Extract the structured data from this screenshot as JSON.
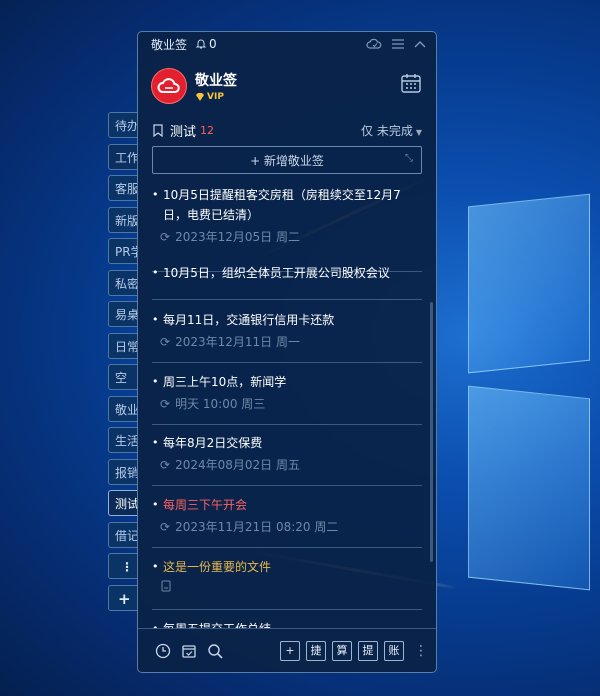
{
  "app": {
    "title": "敬业签",
    "bell_count": "0",
    "user_name": "敬业签",
    "vip_label": "VIP"
  },
  "side_tabs": [
    "待办",
    "工作",
    "客服",
    "新版",
    "PR学",
    "私密",
    "易桌",
    "日常",
    "空",
    "敬业",
    "生活",
    "报销",
    "测试",
    "借记"
  ],
  "side_tab_more": "⋮",
  "side_tab_add": "+",
  "list": {
    "name": "测试",
    "count": "12",
    "filter": "仅 未完成"
  },
  "add_button": "+ 新增敬业签",
  "notes": [
    {
      "title": "10月5日提醒租客交房租（房租续交至12月7日，电费已结清）",
      "meta": "2023年12月05日 周二"
    },
    {
      "title": "10月5日，组织全体员工开展公司股权会议",
      "meta": ""
    },
    {
      "title": "每月11日，交通银行信用卡还款",
      "meta": "2023年12月11日 周一"
    },
    {
      "title": "周三上午10点，新闻学",
      "meta": "明天 10:00 周三"
    },
    {
      "title": "每年8月2日交保费",
      "meta": "2024年08月02日 周五"
    },
    {
      "title": "每周三下午开会",
      "meta": "2023年11月21日 08:20 周二"
    },
    {
      "title": "这是一份重要的文件",
      "meta": ""
    },
    {
      "title": "每周五提交工作总结",
      "meta": ""
    }
  ],
  "bottom_buttons": [
    "+",
    "捷",
    "算",
    "提",
    "账"
  ],
  "colors": {
    "accent_red": "#e3202f",
    "overdue_red": "#ff6262",
    "important_gold": "#e8b84a",
    "vip_gold": "#f6c33a"
  }
}
